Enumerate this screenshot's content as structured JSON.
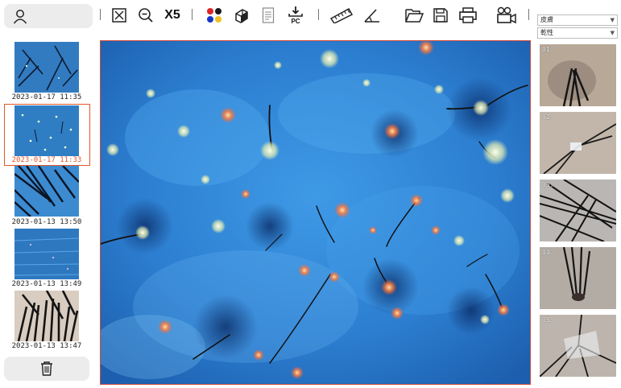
{
  "toolbar": {
    "zoom_label": "X5",
    "pc_label": "PC"
  },
  "thumbnails": [
    {
      "timestamp": "2023-01-17 11:35",
      "selected": false
    },
    {
      "timestamp": "2023-01-17 11:33",
      "selected": true
    },
    {
      "timestamp": "2023-01-13 13:50",
      "selected": false
    },
    {
      "timestamp": "2023-01-13 13:49",
      "selected": false
    },
    {
      "timestamp": "2023-01-13 13:47",
      "selected": false
    }
  ],
  "right_panel": {
    "dropdown_1": "皮膚",
    "dropdown_2": "乾性",
    "captures": [
      "01.",
      "02.",
      "03.",
      "04.",
      "05."
    ]
  },
  "colors": {
    "accent": "#e2562a",
    "main_border": "#d24a3a",
    "button_bg": "#ececec"
  },
  "icons": [
    "user-icon",
    "fit-screen-icon",
    "zoom-out-icon",
    "color-palette-icon",
    "eraser-icon",
    "document-icon",
    "download-to-pc-icon",
    "ruler-icon",
    "angle-icon",
    "folder-open-icon",
    "save-icon",
    "print-icon",
    "video-camera-icon",
    "trash-icon"
  ]
}
